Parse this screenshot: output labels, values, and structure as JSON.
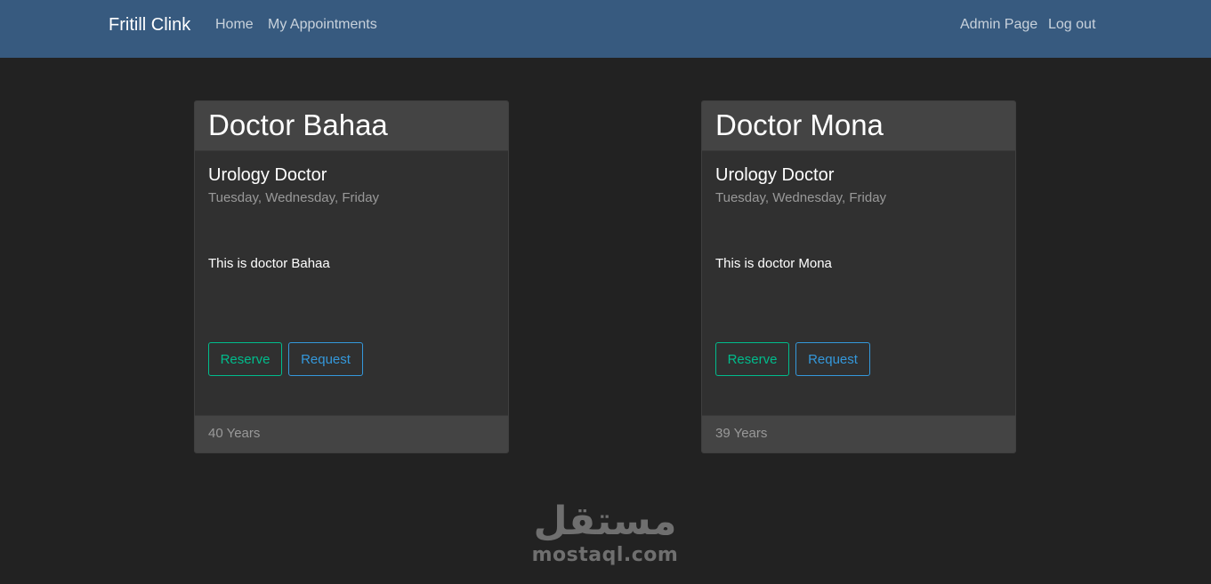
{
  "navbar": {
    "brand": "Fritill Clink",
    "links_left": [
      "Home",
      "My Appointments"
    ],
    "links_right": [
      "Admin Page",
      "Log out"
    ]
  },
  "doctors": [
    {
      "name": "Doctor Bahaa",
      "specialty": "Urology Doctor",
      "days": "Tuesday, Wednesday, Friday",
      "description": "This is doctor Bahaa",
      "reserve_label": "Reserve",
      "request_label": "Request",
      "age": "40 Years"
    },
    {
      "name": "Doctor Mona",
      "specialty": "Urology Doctor",
      "days": "Tuesday, Wednesday, Friday",
      "description": "This is doctor Mona",
      "reserve_label": "Reserve",
      "request_label": "Request",
      "age": "39 Years"
    }
  ],
  "watermark": {
    "arabic": "مستقل",
    "latin": "mostaql.com"
  },
  "colors": {
    "navbar": "#375a7f",
    "background": "#222222",
    "reserve": "#00bc8c",
    "request": "#3498db"
  }
}
